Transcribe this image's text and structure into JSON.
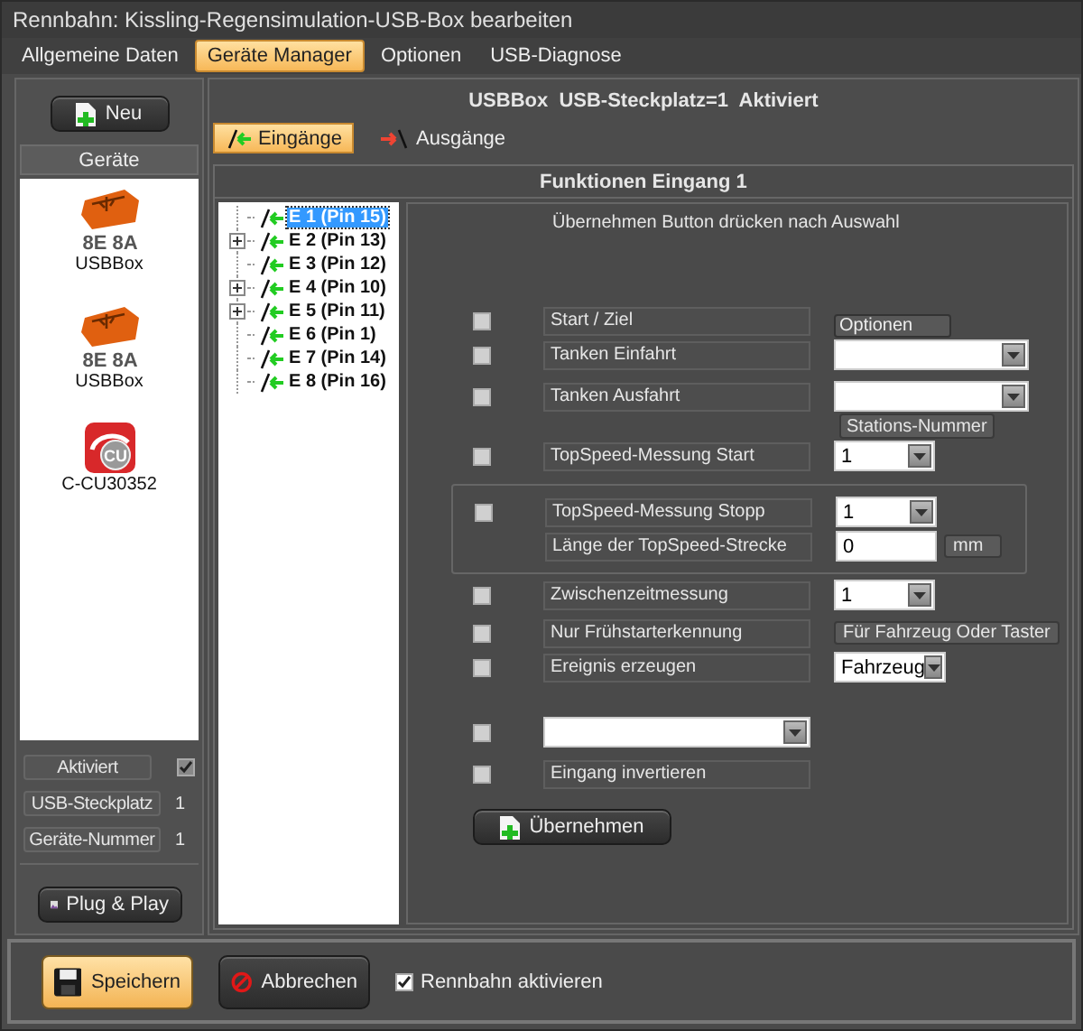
{
  "window": {
    "title": "Rennbahn: Kissling-Regensimulation-USB-Box bearbeiten"
  },
  "menu_tabs": [
    {
      "label": "Allgemeine Daten",
      "selected": false
    },
    {
      "label": "Geräte Manager",
      "selected": true
    },
    {
      "label": "Optionen",
      "selected": false
    },
    {
      "label": "USB-Diagnose",
      "selected": false
    }
  ],
  "sidebar": {
    "new_button": "Neu",
    "header": "Geräte",
    "devices": [
      {
        "kind": "usbbox",
        "badge": "8E 8A",
        "label": "USBBox"
      },
      {
        "kind": "usbbox",
        "badge": "8E 8A",
        "label": "USBBox"
      },
      {
        "kind": "cu",
        "badge": "CU",
        "label": "C-CU30352"
      }
    ],
    "properties": [
      {
        "label": "Aktiviert",
        "kind": "check",
        "checked": true
      },
      {
        "label": "USB-Steckplatz",
        "kind": "value",
        "value": "1"
      },
      {
        "label": "Geräte-Nummer",
        "kind": "value",
        "value": "1"
      }
    ],
    "plug_button": "Plug & Play"
  },
  "device_panel": {
    "header": "USBBox  USB-Steckplatz=1  Aktiviert",
    "tabs": [
      {
        "label": "Eingänge",
        "kind": "in",
        "selected": true
      },
      {
        "label": "Ausgänge",
        "kind": "out",
        "selected": false
      }
    ],
    "section_title": "Funktionen Eingang 1",
    "tree": [
      {
        "label": "E 1 (Pin 15)",
        "selected": true,
        "collapsed": false
      },
      {
        "label": "E 2 (Pin 13)",
        "selected": false,
        "collapsed": true
      },
      {
        "label": "E 3 (Pin 12)",
        "selected": false,
        "collapsed": false
      },
      {
        "label": "E 4 (Pin 10)",
        "selected": false,
        "collapsed": true
      },
      {
        "label": "E 5 (Pin 11)",
        "selected": false,
        "collapsed": true
      },
      {
        "label": "E 6 (Pin 1)",
        "selected": false,
        "collapsed": false
      },
      {
        "label": "E 7 (Pin 14)",
        "selected": false,
        "collapsed": false
      },
      {
        "label": "E 8 (Pin 16)",
        "selected": false,
        "collapsed": false
      }
    ],
    "hint": "Übernehmen Button drücken nach Auswahl",
    "rows": [
      {
        "kind": "check",
        "checked": false,
        "label": "Start / Ziel",
        "extra": {
          "kind": "button",
          "text": "Optionen"
        }
      },
      {
        "kind": "check",
        "checked": false,
        "label": "Tanken Einfahrt",
        "extra": {
          "kind": "combo"
        }
      },
      {
        "kind": "check",
        "checked": false,
        "label": "Tanken Ausfahrt",
        "extra": {
          "kind": "combo"
        }
      },
      {
        "kind": "check",
        "checked": false,
        "label": "TopSpeed-Messung Start",
        "caption": "Stations-Nummer",
        "extra": {
          "kind": "combo",
          "value": "1"
        }
      },
      {
        "kind": "group",
        "rows": [
          {
            "kind": "check",
            "checked": false,
            "label": "TopSpeed-Messung Stopp",
            "extra": {
              "kind": "combo",
              "value": "1"
            }
          },
          {
            "kind": "field",
            "label": "Länge der TopSpeed-Strecke",
            "extra": {
              "kind": "input",
              "value": "0",
              "unit": "mm"
            }
          }
        ]
      },
      {
        "kind": "check",
        "checked": false,
        "label": "Zwischenzeitmessung",
        "extra": {
          "kind": "combo",
          "value": "1"
        }
      },
      {
        "kind": "check",
        "checked": false,
        "label": "Nur Frühstarterkennung",
        "extra": {
          "kind": "note",
          "text": "Für Fahrzeug Oder Taster"
        }
      },
      {
        "kind": "check",
        "checked": false,
        "label": "Ereignis erzeugen",
        "extra": {
          "kind": "combo",
          "value": "Fahrzeug"
        }
      },
      {
        "kind": "check-combo",
        "checked": false
      },
      {
        "kind": "check",
        "checked": false,
        "label": "Eingang invertieren"
      }
    ],
    "apply_button": "Übernehmen"
  },
  "footer": {
    "save_button": "Speichern",
    "cancel_button": "Abbrechen",
    "activate": {
      "label": "Rennbahn aktivieren",
      "checked": true
    }
  }
}
